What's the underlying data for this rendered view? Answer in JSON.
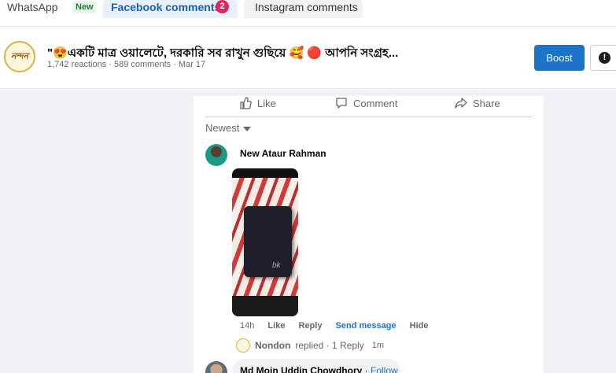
{
  "tabs": {
    "whatsapp": "WhatsApp",
    "whatsapp_badge": "New",
    "facebook": "Facebook comments",
    "facebook_count": "2",
    "instagram": "Instagram comments"
  },
  "post": {
    "avatar_text": "নন্দন",
    "title": "\"😍একটি মাত্র ওয়ালেটে, দরকারি সব রাখুন গুছিয়ে 🥰 🔴 আপনি সংগ্রহ...",
    "meta": "1,742 reactions · 589 comments · Mar 17",
    "boost_label": "Boost",
    "more_icon_text": "!"
  },
  "actions": {
    "like": "Like",
    "comment": "Comment",
    "share": "Share"
  },
  "sort_label": "Newest",
  "comment": {
    "author": "New Ataur Rahman",
    "image_logo": "bk",
    "time": "14h",
    "like": "Like",
    "reply": "Reply",
    "send_message": "Send message",
    "hide": "Hide"
  },
  "reply_summary": {
    "name": "Nondon",
    "text": "replied · 1 Reply",
    "time": "1m"
  },
  "next_comment": {
    "author": "Md Moin Uddin Chowdhory",
    "separator": " · ",
    "follow": "Follow"
  },
  "colors": {
    "accent": "#1d73c9",
    "badge_red": "#e0245e",
    "background": "#f0f2f5"
  }
}
